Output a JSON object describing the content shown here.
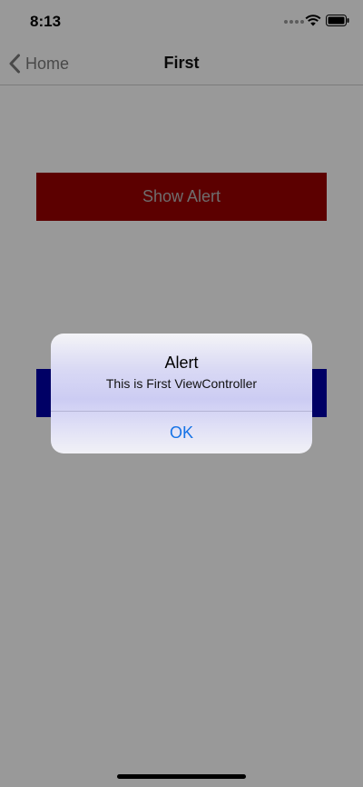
{
  "status_bar": {
    "time": "8:13",
    "icons": [
      "signal-dots-icon",
      "wifi-icon",
      "battery-icon"
    ]
  },
  "nav_bar": {
    "back_label": "Home",
    "back_icon": "chevron-left-icon",
    "title": "First"
  },
  "content": {
    "show_alert_label": "Show Alert",
    "show_alert_color": "#990000",
    "second_button_color": "#0000a8"
  },
  "alert": {
    "title": "Alert",
    "message": "This is First ViewController",
    "ok_label": "OK",
    "ok_color": "#1673e6"
  }
}
